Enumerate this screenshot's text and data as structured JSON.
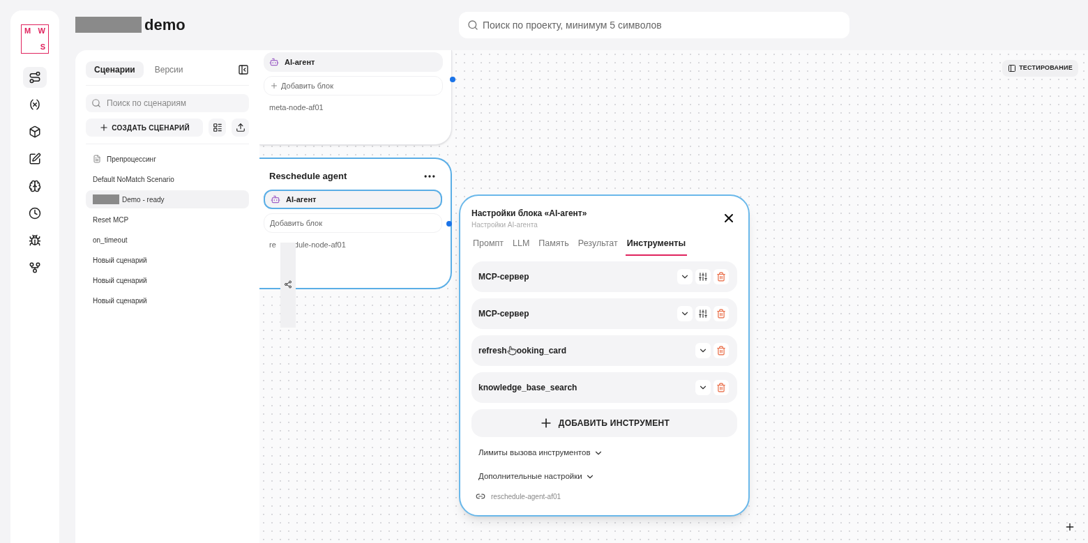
{
  "logo": {
    "letters": [
      "M",
      "W",
      "S"
    ]
  },
  "rail": [
    {
      "kind": "route",
      "selected": true
    },
    {
      "kind": "variable",
      "selected": false
    },
    {
      "kind": "cube",
      "selected": false
    },
    {
      "kind": "note",
      "selected": false
    },
    {
      "kind": "brain",
      "selected": false
    },
    {
      "kind": "clock",
      "selected": false
    },
    {
      "kind": "bug",
      "selected": false
    },
    {
      "kind": "fork",
      "selected": false
    }
  ],
  "header": {
    "title": "demo",
    "search": {
      "placeholder": "Поиск по проекту, минимум 5 символов"
    }
  },
  "sidebar": {
    "tabs": [
      {
        "label": "Сценарии",
        "selected": true
      },
      {
        "label": "Версии",
        "selected": false
      }
    ],
    "search": {
      "placeholder": "Поиск по сценариям"
    },
    "create_button": "СОЗДАТЬ СЦЕНАРИЙ",
    "items": [
      {
        "label": "Препроцессинг",
        "kind": "file",
        "selected": false
      },
      {
        "label": "Default NoMatch Scenario",
        "kind": "plain",
        "selected": false
      },
      {
        "label": "Demo - ready",
        "kind": "redacted",
        "selected": true
      },
      {
        "label": "Reset MCP",
        "kind": "plain",
        "selected": false
      },
      {
        "label": "on_timeout",
        "kind": "plain",
        "selected": false
      },
      {
        "label": "Новый сценарий",
        "kind": "plain",
        "selected": false
      },
      {
        "label": "Новый сценарий",
        "kind": "plain",
        "selected": false
      },
      {
        "label": "Новый сценарий",
        "kind": "plain",
        "selected": false
      }
    ]
  },
  "canvas": {
    "testing_button": "ТЕСТИРОВАНИЕ",
    "nodes": [
      {
        "selected": false,
        "block": {
          "label": "AI-агент",
          "selected": false
        },
        "add_block": "Добавить блок",
        "node_id": [
          "meta-node-af01"
        ]
      },
      {
        "title": "Reschedule agent",
        "selected": true,
        "block": {
          "label": "AI-агент",
          "selected": true
        },
        "add_block": "Добавить блок",
        "node_id": [
          "re",
          "dule-node-af01"
        ]
      }
    ],
    "dialog": {
      "title": "Настройки блока «AI-агент»",
      "subtitle": "Настройки AI-агента",
      "tabs": [
        {
          "label": "Промпт",
          "selected": false
        },
        {
          "label": "LLM",
          "selected": false
        },
        {
          "label": "Память",
          "selected": false
        },
        {
          "label": "Результат",
          "selected": false
        },
        {
          "label": "Инструменты",
          "selected": true
        }
      ],
      "tools": [
        {
          "kind": "mcp",
          "label": [
            "MCP-сервер"
          ]
        },
        {
          "kind": "mcp",
          "label": [
            "MCP-сервер"
          ]
        },
        {
          "kind": "function",
          "label": [
            "refresh",
            "ooking_card"
          ]
        },
        {
          "kind": "function",
          "label": [
            "knowledge_base_search"
          ]
        }
      ],
      "add_tool": "ДОБАВИТЬ ИНСТРУМЕНТ",
      "sections": [
        {
          "label": "Лимиты вызова инструментов",
          "expanded": false
        },
        {
          "label": "Дополнительные настройки",
          "expanded": false
        }
      ],
      "block_id": "reschedule-agent-af01"
    }
  }
}
